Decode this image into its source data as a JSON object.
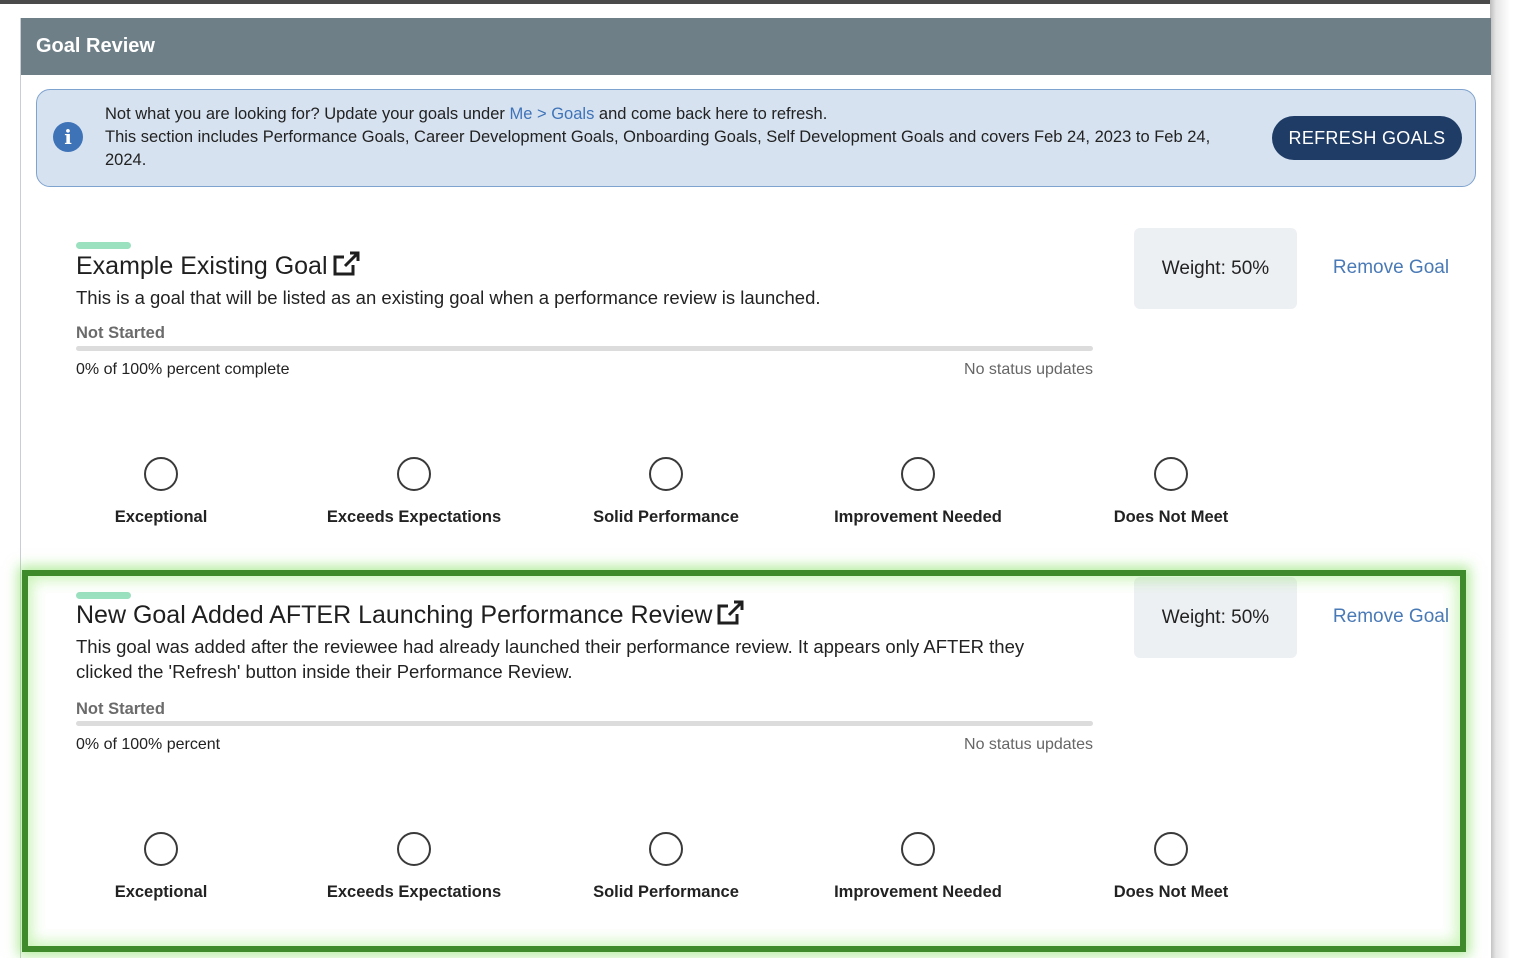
{
  "panel": {
    "title": "Goal Review"
  },
  "banner": {
    "line1_prefix": "Not what you are looking for? Update your goals under ",
    "link_text": "Me > Goals",
    "line1_suffix": " and come back here to refresh.",
    "line2": "This section includes Performance Goals, Career Development Goals, Onboarding Goals, Self Development Goals and covers Feb 24, 2023 to Feb 24, 2024.",
    "refresh_label": "REFRESH GOALS"
  },
  "goals": [
    {
      "title": "Example Existing Goal",
      "description": "This is a goal that will be listed as an existing goal when a performance review is launched.",
      "status": "Not Started",
      "progress_fraction": 0,
      "percent_text": "0% of 100% percent complete",
      "status_updates": "No status updates",
      "weight": "Weight: 50%",
      "remove_label": "Remove Goal"
    },
    {
      "title": "New Goal Added AFTER Launching Performance Review",
      "description": "This goal was added after the reviewee had already launched their performance review. It appears only AFTER they clicked the 'Refresh' button inside their Performance Review.",
      "status": "Not Started",
      "progress_fraction": 0,
      "percent_text": "0% of 100% percent",
      "status_updates": "No status updates",
      "weight": "Weight: 50%",
      "remove_label": "Remove Goal"
    }
  ],
  "ratings": [
    "Exceptional",
    "Exceeds Expectations",
    "Solid Performance",
    "Improvement Needed",
    "Does Not Meet"
  ],
  "colors": {
    "header_bg": "#6e7f88",
    "banner_bg": "#d6e2f0",
    "button_bg": "#1f3c66",
    "link": "#4a7ab6",
    "accent": "#9be0bf",
    "highlight": "#3f8a2b"
  },
  "icons": {
    "info": "info-circle-icon",
    "external_link": "external-link-icon"
  }
}
